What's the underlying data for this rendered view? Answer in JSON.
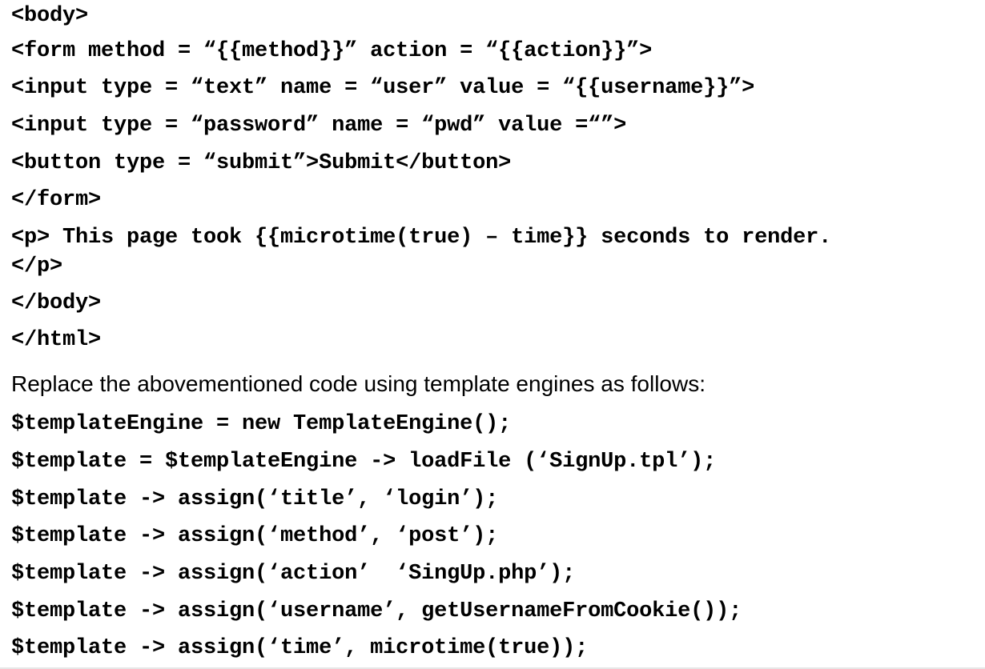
{
  "html_code": [
    "<body>",
    "<form method = “{{method}}” action = “{{action}}”>",
    "<input type = “text” name = “user” value = “{{username}}”>",
    "<input type = “password” name = “pwd” value =“”>",
    "<button type = “submit”>Submit</button>",
    "</form>",
    "<p> This page took {{microtime(true) – time}} seconds to render.",
    "</p>",
    "</body>",
    "</html>"
  ],
  "instruction_text": "Replace the abovementioned code using template engines as follows:",
  "php_code": [
    "$templateEngine = new TemplateEngine();",
    "$template = $templateEngine -> loadFile (‘SignUp.tpl’);",
    "$template -> assign(‘title’, ‘login’);",
    "$template -> assign(‘method’, ‘post’);",
    "$template -> assign(‘action’  ‘SingUp.php’);",
    "$template -> assign(‘username’, getUsernameFromCookie());",
    "$template -> assign(‘time’, microtime(true));"
  ]
}
